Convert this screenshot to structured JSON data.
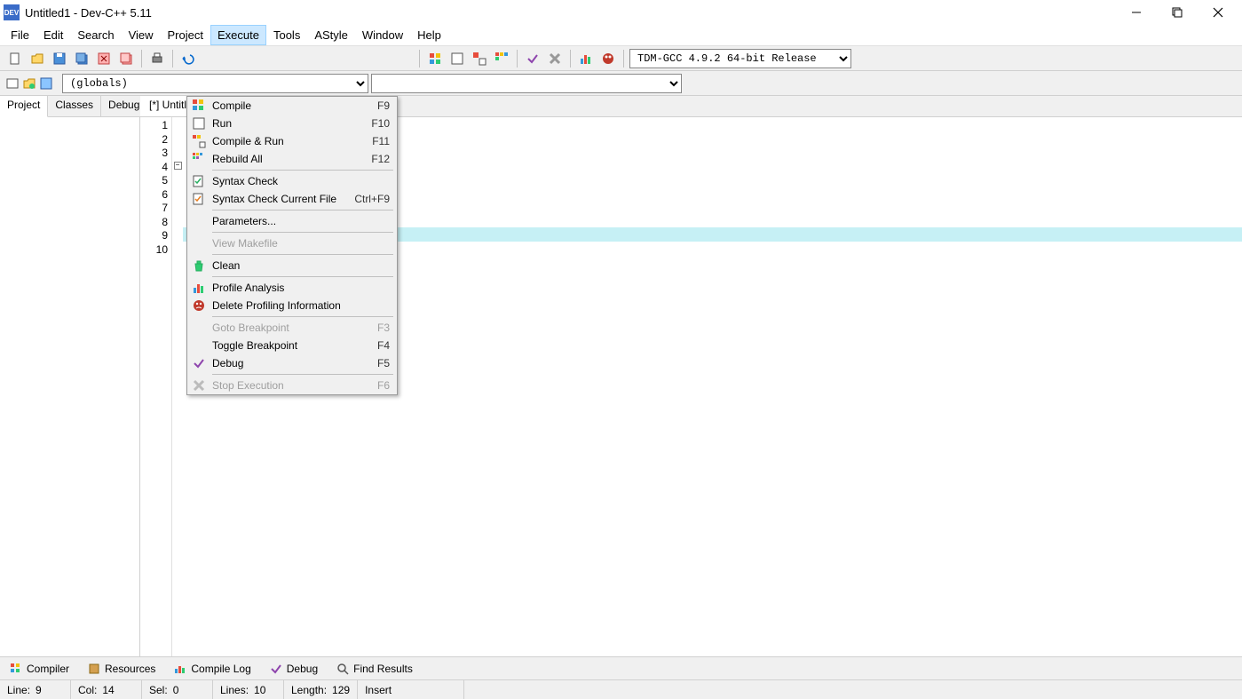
{
  "title": "Untitled1 - Dev-C++ 5.11",
  "menubar": [
    "File",
    "Edit",
    "Search",
    "View",
    "Project",
    "Execute",
    "Tools",
    "AStyle",
    "Window",
    "Help"
  ],
  "menubar_active_index": 5,
  "compiler": "TDM-GCC 4.9.2 64-bit Release",
  "scope": "(globals)",
  "side_tabs": [
    "Project",
    "Classes",
    "Debug"
  ],
  "side_tab_active": 0,
  "file_tab": "[*] Untitled1",
  "gutter_lines": [
    "1",
    "2",
    "3",
    "4",
    "5",
    "6",
    "7",
    "8",
    "9",
    "10"
  ],
  "highlighted_line_index": 8,
  "fold_line_index": 3,
  "execute_menu": {
    "groups": [
      [
        {
          "icon": "compile",
          "label": "Compile",
          "shortcut": "F9"
        },
        {
          "icon": "run",
          "label": "Run",
          "shortcut": "F10"
        },
        {
          "icon": "compile-run",
          "label": "Compile & Run",
          "shortcut": "F11"
        },
        {
          "icon": "rebuild",
          "label": "Rebuild All",
          "shortcut": "F12"
        }
      ],
      [
        {
          "icon": "syntax",
          "label": "Syntax Check",
          "shortcut": ""
        },
        {
          "icon": "syntax-file",
          "label": "Syntax Check Current File",
          "shortcut": "Ctrl+F9"
        }
      ],
      [
        {
          "icon": "",
          "label": "Parameters...",
          "shortcut": ""
        }
      ],
      [
        {
          "icon": "",
          "label": "View Makefile",
          "shortcut": "",
          "disabled": true
        }
      ],
      [
        {
          "icon": "clean",
          "label": "Clean",
          "shortcut": ""
        }
      ],
      [
        {
          "icon": "profile",
          "label": "Profile Analysis",
          "shortcut": ""
        },
        {
          "icon": "del-profile",
          "label": "Delete Profiling Information",
          "shortcut": ""
        }
      ],
      [
        {
          "icon": "",
          "label": "Goto Breakpoint",
          "shortcut": "F3",
          "disabled": true
        },
        {
          "icon": "",
          "label": "Toggle Breakpoint",
          "shortcut": "F4"
        },
        {
          "icon": "debug",
          "label": "Debug",
          "shortcut": "F5"
        }
      ],
      [
        {
          "icon": "stop",
          "label": "Stop Execution",
          "shortcut": "F6",
          "disabled": true
        }
      ]
    ]
  },
  "bottom_tabs": [
    {
      "icon": "compiler",
      "label": "Compiler"
    },
    {
      "icon": "resources",
      "label": "Resources"
    },
    {
      "icon": "compilelog",
      "label": "Compile Log"
    },
    {
      "icon": "debug",
      "label": "Debug"
    },
    {
      "icon": "find",
      "label": "Find Results"
    }
  ],
  "status": {
    "line_lbl": "Line:",
    "line_val": "9",
    "col_lbl": "Col:",
    "col_val": "14",
    "sel_lbl": "Sel:",
    "sel_val": "0",
    "lines_lbl": "Lines:",
    "lines_val": "10",
    "length_lbl": "Length:",
    "length_val": "129",
    "mode": "Insert"
  }
}
